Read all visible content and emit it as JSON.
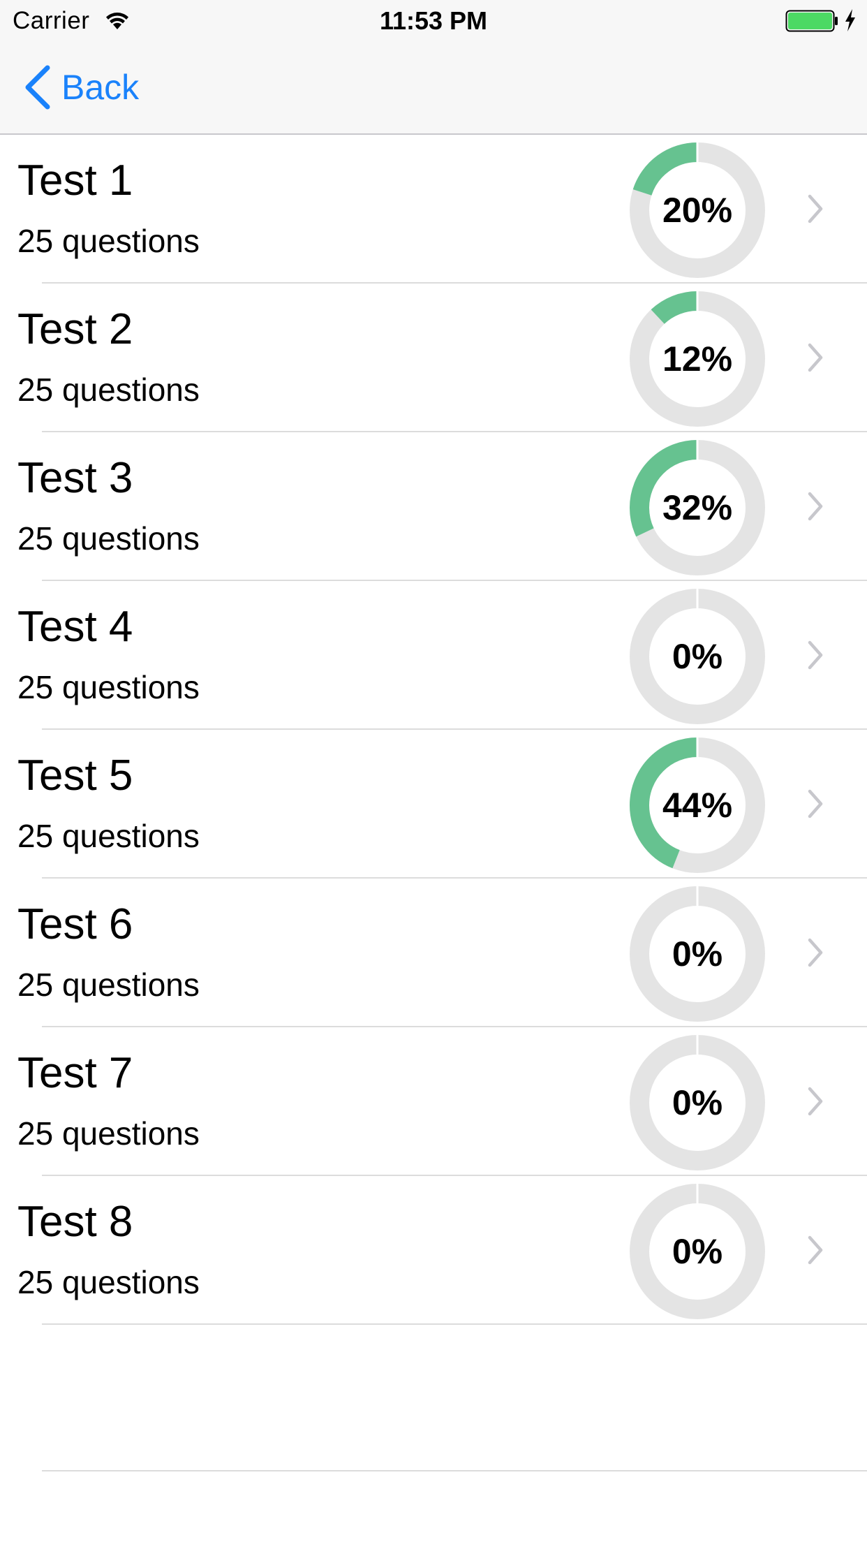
{
  "status_bar": {
    "carrier": "Carrier",
    "time": "11:53 PM",
    "wifi_icon": "wifi-icon",
    "battery_icon": "battery-icon",
    "battery_color": "#4cd964"
  },
  "nav": {
    "back_label": "Back",
    "back_icon": "chevron-left-icon",
    "tint_color": "#1a82fb"
  },
  "colors": {
    "progress": "#66c290",
    "track": "#e4e4e4"
  },
  "tests": [
    {
      "title": "Test 1",
      "subtitle": "25 questions",
      "percent_label": "20%",
      "progress": 0.2
    },
    {
      "title": "Test 2",
      "subtitle": "25 questions",
      "percent_label": "12%",
      "progress": 0.12
    },
    {
      "title": "Test 3",
      "subtitle": "25 questions",
      "percent_label": "32%",
      "progress": 0.32
    },
    {
      "title": "Test 4",
      "subtitle": "25 questions",
      "percent_label": "0%",
      "progress": 0.0
    },
    {
      "title": "Test 5",
      "subtitle": "25 questions",
      "percent_label": "44%",
      "progress": 0.44
    },
    {
      "title": "Test 6",
      "subtitle": "25 questions",
      "percent_label": "0%",
      "progress": 0.0
    },
    {
      "title": "Test 7",
      "subtitle": "25 questions",
      "percent_label": "0%",
      "progress": 0.0
    },
    {
      "title": "Test 8",
      "subtitle": "25 questions",
      "percent_label": "0%",
      "progress": 0.0
    }
  ]
}
